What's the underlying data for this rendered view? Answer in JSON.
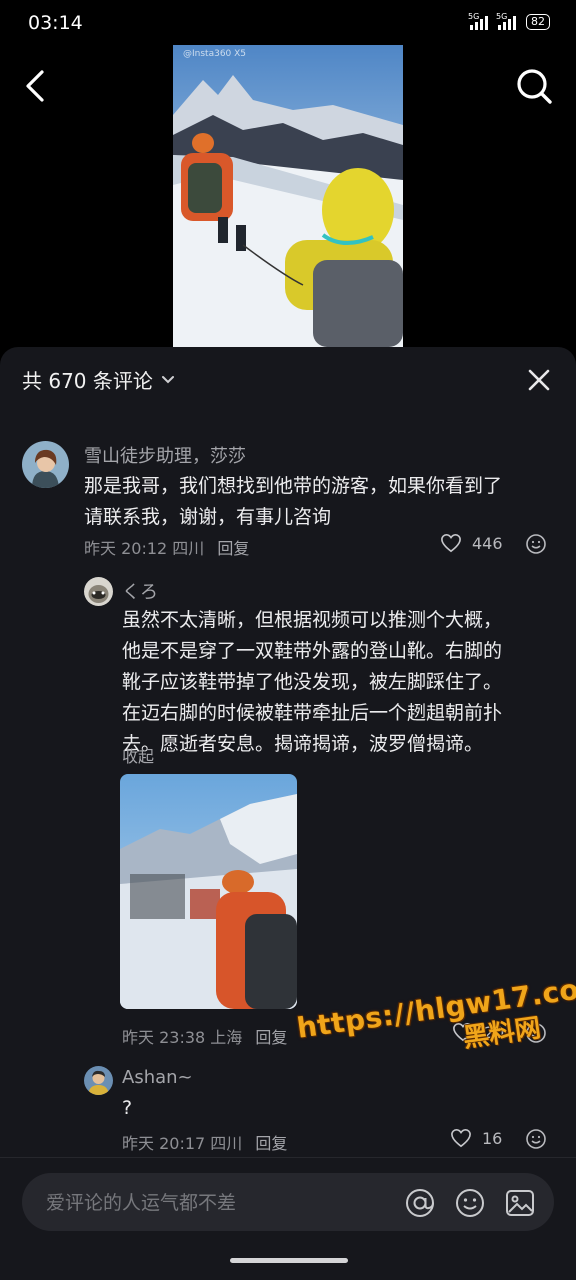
{
  "status_bar": {
    "time": "03:14",
    "sim1_label": "5G",
    "sim2_label": "5G",
    "battery": "82"
  },
  "video": {
    "watermark": "@Insta360 X5"
  },
  "comments_sheet": {
    "header": "共 670 条评论",
    "input_placeholder": "爱评论的人运气都不差"
  },
  "comments": [
    {
      "name": "雪山徒步助理，莎莎",
      "text_lines": [
        "那是我哥，我们想找到他带的游客，如果你看到了",
        "请联系我，谢谢，有事儿咨询"
      ],
      "time": "昨天 20:12",
      "location": "四川",
      "reply": "回复",
      "likes": "446"
    },
    {
      "name": "くろ",
      "text_lines": [
        "虽然不太清晰，但根据视频可以推测个大概，",
        "他是不是穿了一双鞋带外露的登山靴。右脚的",
        "靴子应该鞋带掉了他没发现，被左脚踩住了。",
        "在迈右脚的时候被鞋带牵扯后一个趔趄朝前扑",
        "去。愿逝者安息。揭谛揭谛，波罗僧揭谛。"
      ],
      "collapse": "收起",
      "time": "昨天 23:38",
      "location": "上海",
      "reply": "回复",
      "likes": "20"
    },
    {
      "name": "Ashan~",
      "text_lines": [
        "?"
      ],
      "time": "昨天 20:17",
      "location": "四川",
      "reply": "回复",
      "likes": "16"
    }
  ],
  "overlay_watermark": {
    "url": "https://hlgw17.com",
    "caption": "黑料网"
  },
  "icons": {
    "back": "back-arrow-icon",
    "search": "search-icon",
    "close": "close-icon",
    "chevron": "chevron-down-icon",
    "heart": "heart-icon",
    "emoji": "emoji-icon",
    "at": "at-icon",
    "image": "image-icon"
  },
  "colors": {
    "sheet_bg": "#16171c",
    "input_bg": "#26272d",
    "watermark": "#f0a51a"
  }
}
